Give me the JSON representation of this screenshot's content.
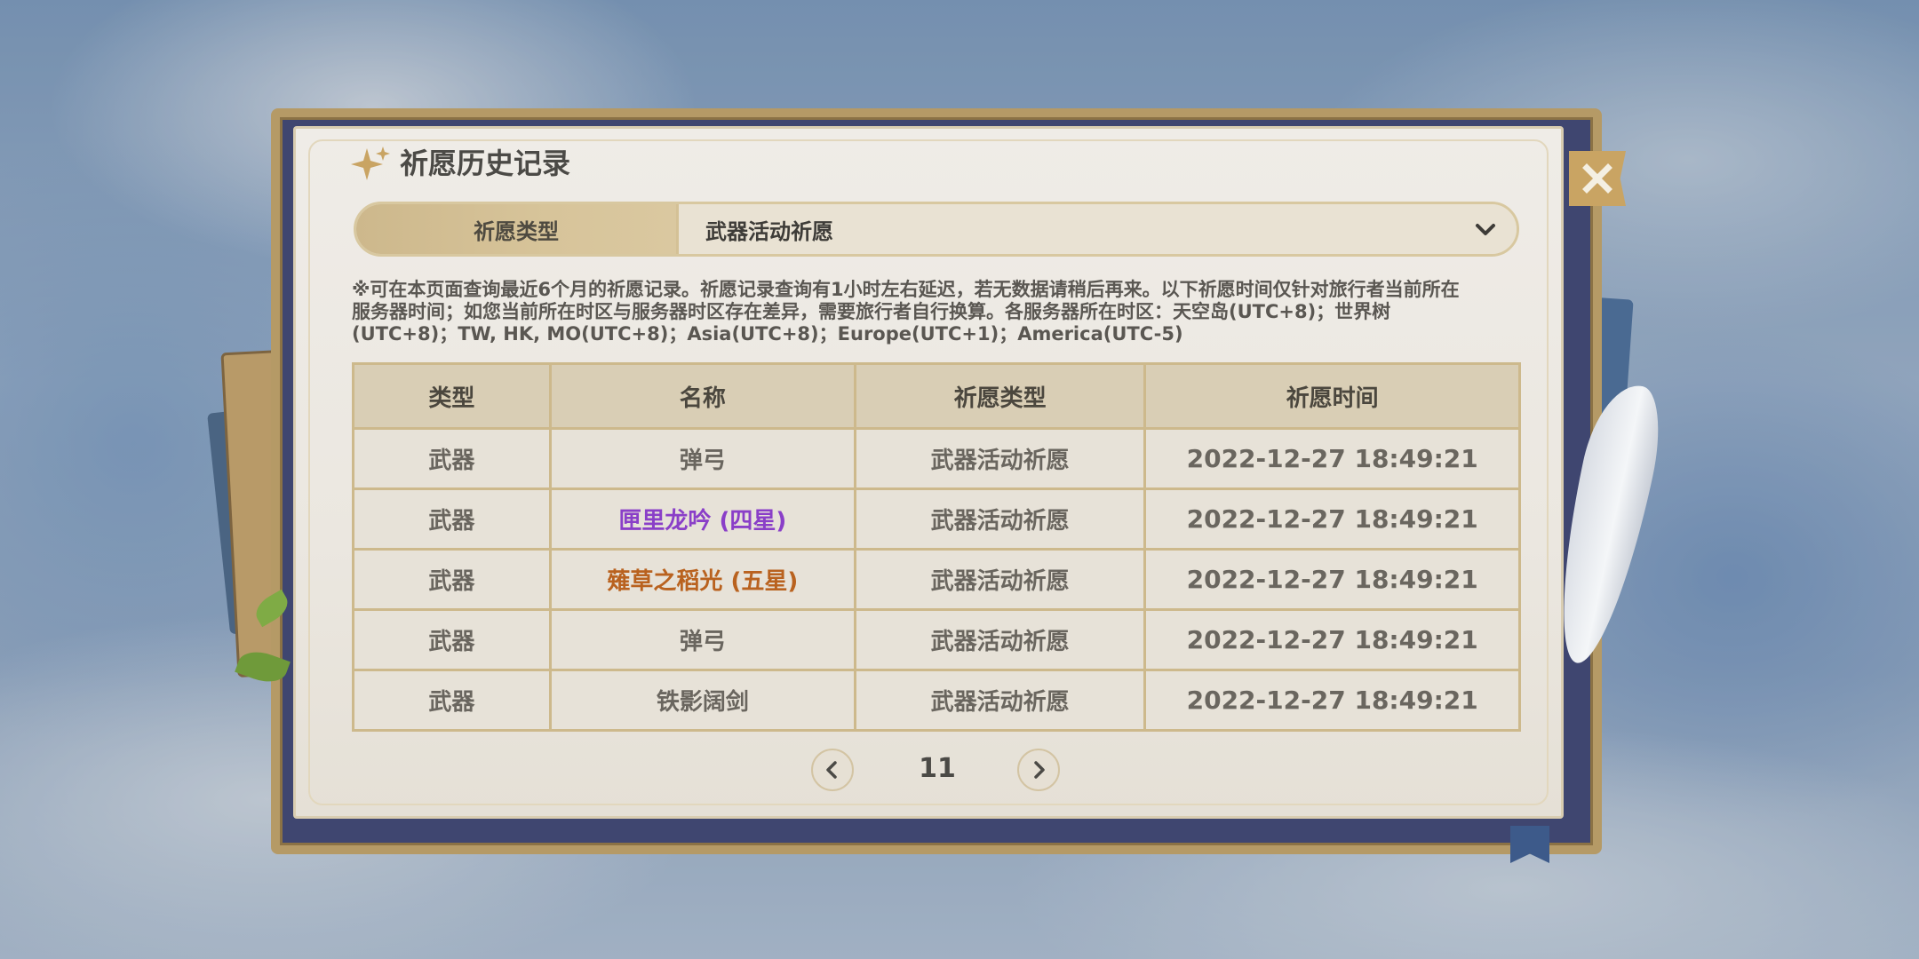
{
  "title": "祈愿历史记录",
  "filter": {
    "label": "祈愿类型",
    "value": "武器活动祈愿"
  },
  "notice_lines": [
    "※可在本页面查询最近6个月的祈愿记录。祈愿记录查询有1小时左右延迟，若无数据请稍后再来。以下祈愿时间仅针对旅行者当前所在",
    "服务器时间；如您当前所在时区与服务器时区存在差异，需要旅行者自行换算。各服务器所在时区：天空岛(UTC+8)；世界树",
    "(UTC+8)；TW, HK, MO(UTC+8)；Asia(UTC+8)；Europe(UTC+1)；America(UTC-5)"
  ],
  "table": {
    "headers": [
      "类型",
      "名称",
      "祈愿类型",
      "祈愿时间"
    ],
    "rows": [
      {
        "type": "武器",
        "name": "弹弓",
        "gacha_type": "武器活动祈愿",
        "time": "2022-12-27 18:49:21"
      },
      {
        "type": "武器",
        "name": "匣里龙吟 (四星)",
        "gacha_type": "武器活动祈愿",
        "time": "2022-12-27 18:49:21"
      },
      {
        "type": "武器",
        "name": "薙草之稻光 (五星)",
        "gacha_type": "武器活动祈愿",
        "time": "2022-12-27 18:49:21"
      },
      {
        "type": "武器",
        "name": "弹弓",
        "gacha_type": "武器活动祈愿",
        "time": "2022-12-27 18:49:21"
      },
      {
        "type": "武器",
        "name": "铁影阔剑",
        "gacha_type": "武器活动祈愿",
        "time": "2022-12-27 18:49:21"
      }
    ]
  },
  "pagination": {
    "current_page": "11"
  },
  "colors": {
    "four_star": "#8a3fc8",
    "five_star": "#b9621f",
    "accent_gold": "#c9a463"
  },
  "icons": {
    "title": "sparkle-icon",
    "close": "close-icon",
    "dropdown": "chevron-down-icon",
    "prev": "chevron-left-icon",
    "next": "chevron-right-icon"
  }
}
